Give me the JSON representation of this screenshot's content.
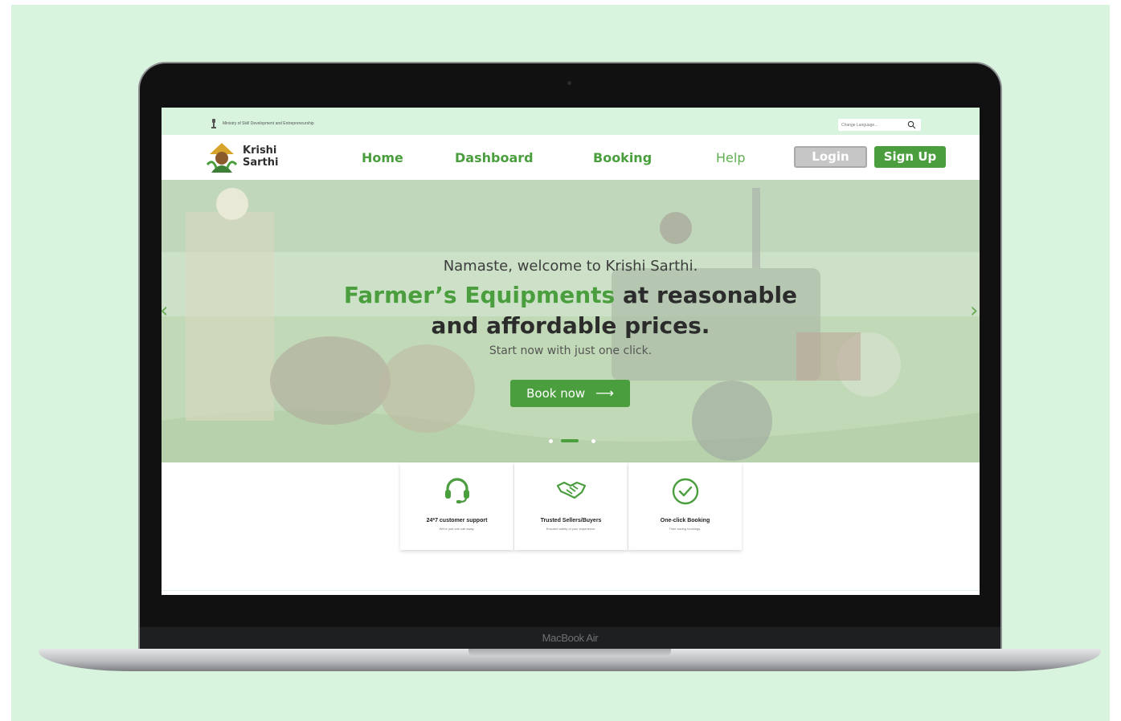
{
  "topbar": {
    "ministry": "Ministry of Skill Development and Entrepreneurship",
    "language_placeholder": "Change Language..."
  },
  "navbar": {
    "brand_line1": "Krishi",
    "brand_line2": "Sarthi",
    "links": [
      "Home",
      "Dashboard",
      "Booking",
      "Help"
    ],
    "login": "Login",
    "signup": "Sign Up"
  },
  "hero": {
    "welcome": "Namaste, welcome to Krishi Sarthi.",
    "headline_accent": "Farmer’s Equipments",
    "headline_rest": "at reasonable",
    "headline_line2": "and affordable prices.",
    "subtext": "Start now with just one click.",
    "cta": "Book now",
    "cta_arrow": "⟶",
    "prev_arrow": "‹",
    "next_arrow": "›"
  },
  "features": [
    {
      "icon": "headset-icon",
      "title": "24*7 customer support",
      "subtitle": "We're just one call away."
    },
    {
      "icon": "handshake-icon",
      "title": "Trusted Sellers/Buyers",
      "subtitle": "Ensured safety of your experience."
    },
    {
      "icon": "check-circle-icon",
      "title": "One-click Booking",
      "subtitle": "Time saving bookings."
    }
  ],
  "device": {
    "label": "MacBook Air"
  },
  "colors": {
    "brand_green": "#4a9e3e",
    "background_mint": "#d8f4de",
    "login_gray": "#c6c6c6"
  }
}
